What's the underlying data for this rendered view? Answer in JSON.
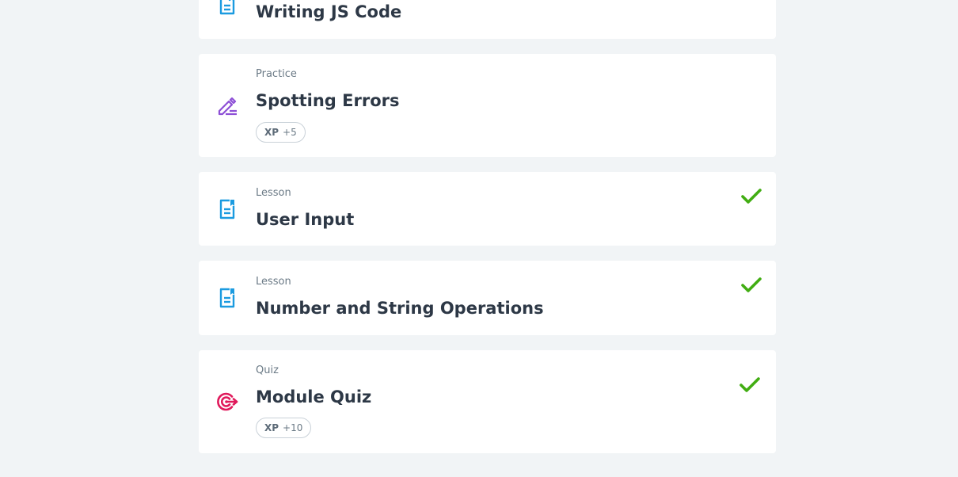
{
  "items": [
    {
      "kind": "",
      "title": "Writing JS Code",
      "icon": "lesson-doc-icon",
      "completed": false
    },
    {
      "kind": "Practice",
      "title": "Spotting Errors",
      "icon": "practice-pencil-icon",
      "xp_label": "XP",
      "xp_value": "+5",
      "completed": false
    },
    {
      "kind": "Lesson",
      "title": "User Input",
      "icon": "lesson-doc-icon",
      "completed": true
    },
    {
      "kind": "Lesson",
      "title": "Number and String Operations",
      "icon": "lesson-doc-icon",
      "completed": true
    },
    {
      "kind": "Quiz",
      "title": "Module Quiz",
      "icon": "quiz-target-icon",
      "xp_label": "XP",
      "xp_value": "+10",
      "completed": true
    }
  ],
  "colors": {
    "background": "#f1f4f6",
    "lesson_icon": "#1b9be0",
    "practice_icon": "#8d4fd6",
    "quiz_icon": "#e0195b",
    "check": "#41ad12"
  }
}
